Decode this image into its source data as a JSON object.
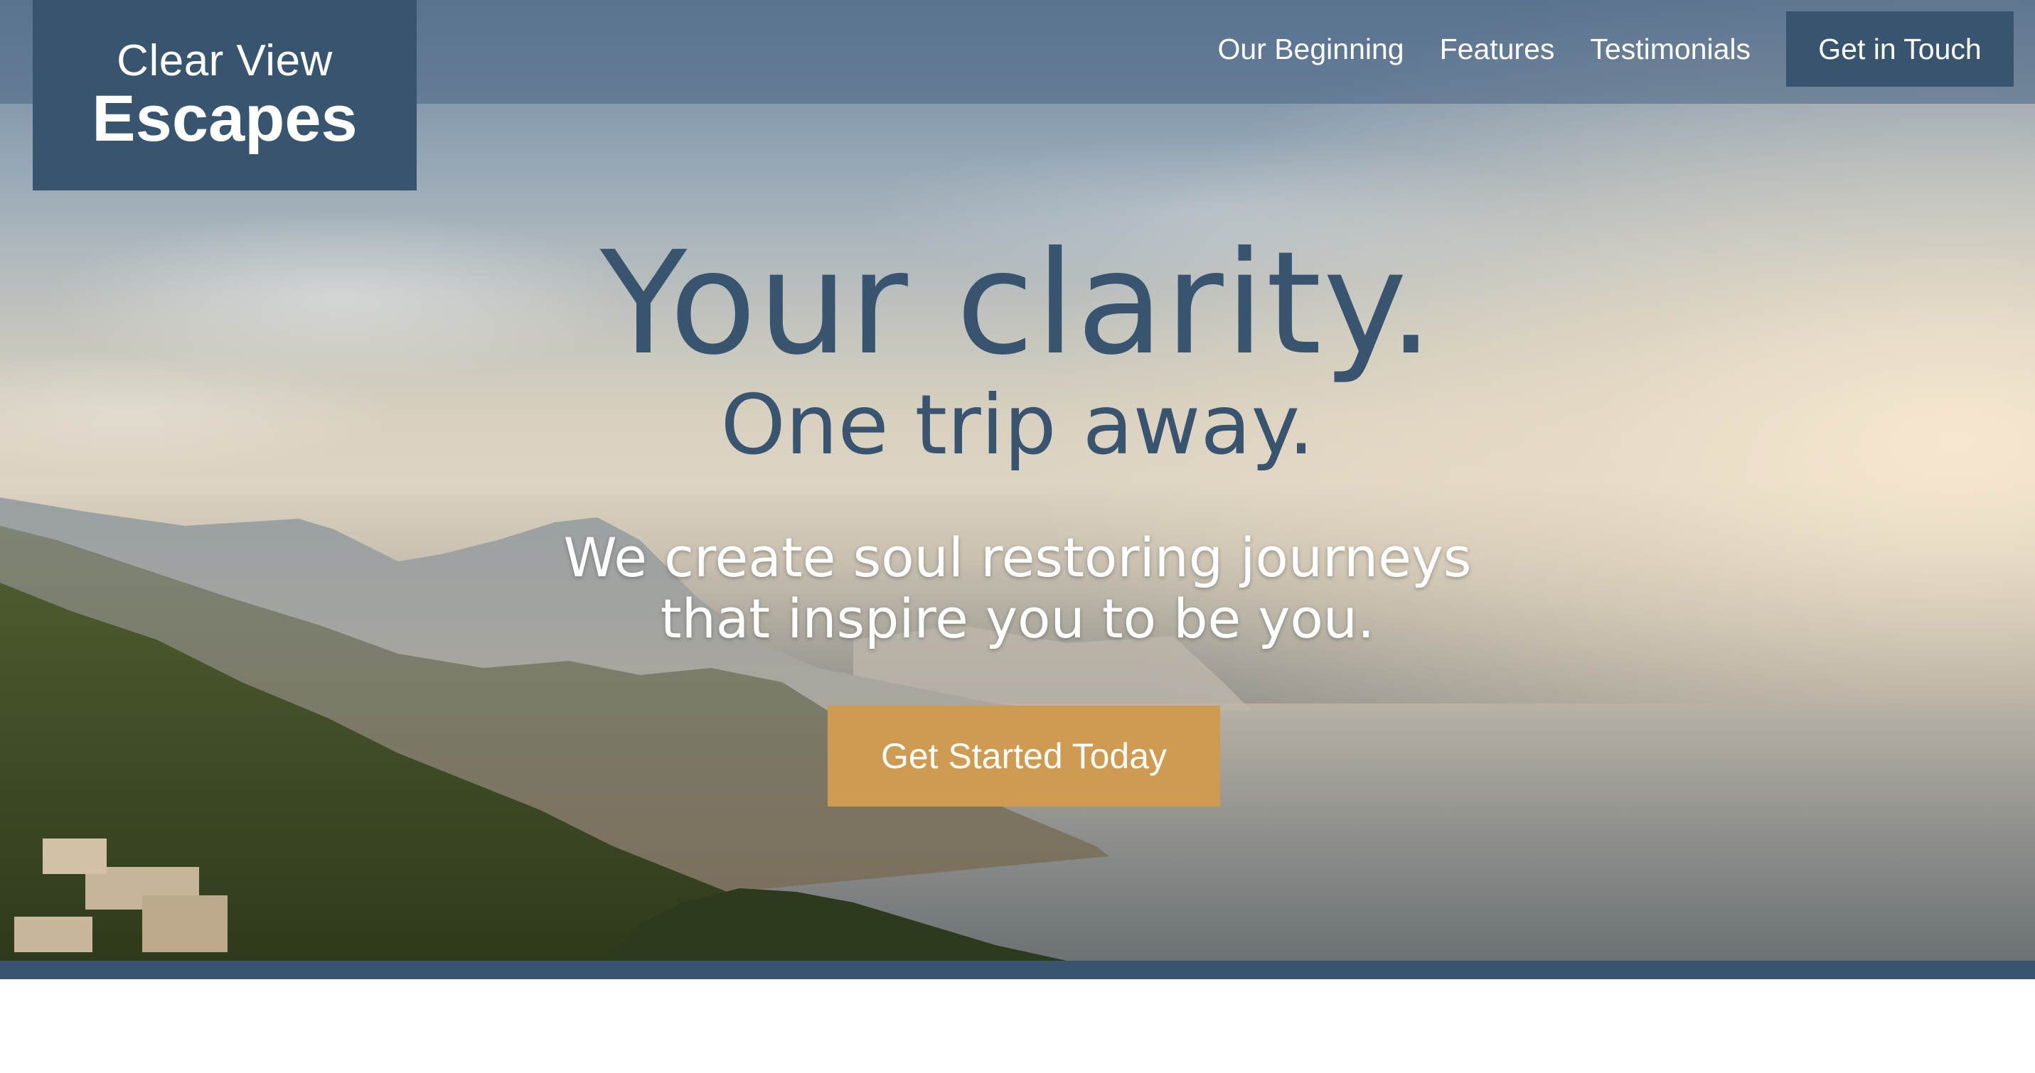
{
  "header": {
    "logo": {
      "line1": "Clear View",
      "line2": "Escapes"
    },
    "nav": [
      {
        "label": "Our Beginning"
      },
      {
        "label": "Features"
      },
      {
        "label": "Testimonials"
      }
    ],
    "cta_label": "Get in Touch"
  },
  "hero": {
    "headline": "Your clarity.",
    "subheadline": "One trip away.",
    "tagline_line1": "We create soul restoring journeys",
    "tagline_line2": "that inspire you to be you.",
    "cta_label": "Get Started Today",
    "background_image": "coastal-mountains-sea-photo"
  },
  "colors": {
    "brand_navy": "#38556f",
    "accent_gold": "#cf9b50",
    "text_white": "#ffffff"
  }
}
